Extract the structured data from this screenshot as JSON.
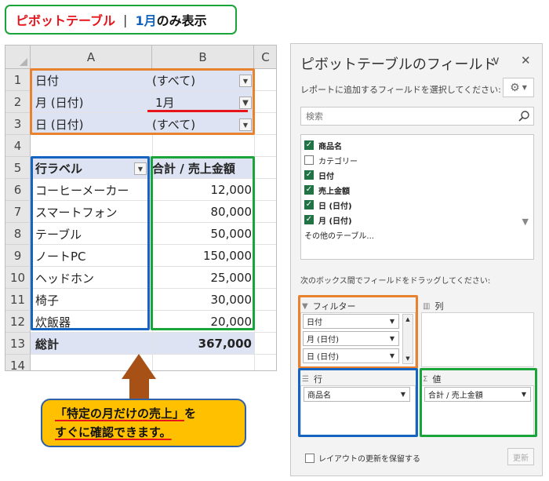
{
  "title": {
    "part1": "ピボットテーブル",
    "separator": "|",
    "part2": "1月",
    "part3": "のみ表示"
  },
  "sheet": {
    "columns": [
      "A",
      "B",
      "C"
    ],
    "rows": [
      "1",
      "2",
      "3",
      "4",
      "5",
      "6",
      "7",
      "8",
      "9",
      "10",
      "11",
      "12",
      "13",
      "14"
    ],
    "filters": [
      {
        "label": "日付",
        "value": "(すべて)"
      },
      {
        "label": "月 (日付)",
        "value": "1月"
      },
      {
        "label": "日 (日付)",
        "value": "(すべて)"
      }
    ],
    "header": {
      "row_label": "行ラベル",
      "sum_label": "合計 / 売上金額"
    },
    "items": [
      {
        "name": "コーヒーメーカー",
        "value": "12,000"
      },
      {
        "name": "スマートフォン",
        "value": "80,000"
      },
      {
        "name": "テーブル",
        "value": "50,000"
      },
      {
        "name": "ノートPC",
        "value": "150,000"
      },
      {
        "name": "ヘッドホン",
        "value": "25,000"
      },
      {
        "name": "椅子",
        "value": "30,000"
      },
      {
        "name": "炊飯器",
        "value": "20,000"
      }
    ],
    "total": {
      "label": "総計",
      "value": "367,000"
    }
  },
  "callout": {
    "line1": "「特定の月だけの売上」",
    "line1_suffix": "を",
    "line2": "すぐに確認できます。"
  },
  "pane": {
    "title": "ピボットテーブルのフィールド",
    "subtitle": "レポートに追加するフィールドを選択してください:",
    "search_placeholder": "検索",
    "fields": [
      {
        "label": "商品名",
        "checked": true
      },
      {
        "label": "カテゴリー",
        "checked": false
      },
      {
        "label": "日付",
        "checked": true
      },
      {
        "label": "売上金額",
        "checked": true
      },
      {
        "label": "日 (日付)",
        "checked": true
      },
      {
        "label": "月 (日付)",
        "checked": true
      }
    ],
    "more_tables": "その他のテーブル...",
    "drag_label": "次のボックス間でフィールドをドラッグしてください:",
    "areas": {
      "filter": {
        "label": "フィルター",
        "items": [
          "日付",
          "月 (日付)",
          "日 (日付)"
        ]
      },
      "columns": {
        "label": "列"
      },
      "rows": {
        "label": "行",
        "items": [
          "商品名"
        ]
      },
      "values": {
        "label": "値",
        "items": [
          "合計 / 売上金額"
        ]
      }
    },
    "defer_label": "レイアウトの更新を保留する",
    "update_label": "更新"
  },
  "colors": {
    "orange": "#e8822e",
    "blue": "#1565c0",
    "green": "#19a53a",
    "red": "#e8141b",
    "callout": "#ffc000",
    "arrow": "#a75116"
  }
}
